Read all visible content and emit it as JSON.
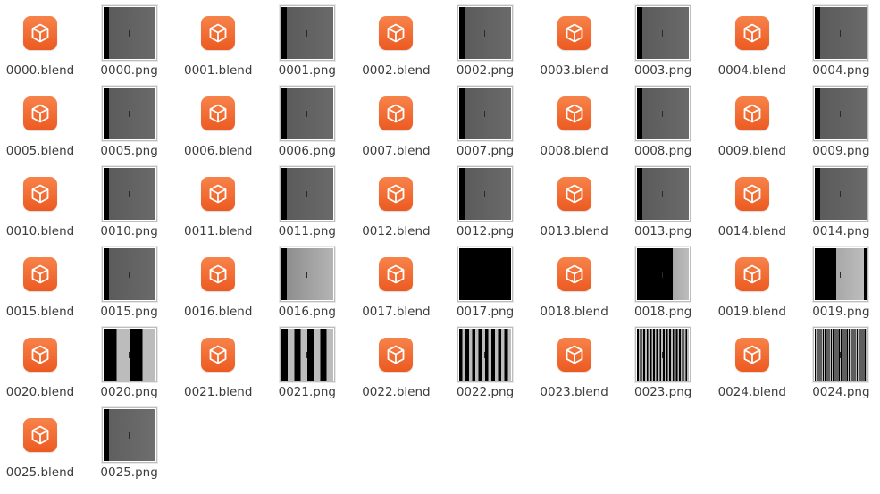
{
  "colors": {
    "blend_icon": "#ef6a2c",
    "label_text": "#3c3c3c"
  },
  "files": [
    {
      "label": "0000.blend",
      "type": "blend"
    },
    {
      "label": "0000.png",
      "type": "png",
      "style": "gray"
    },
    {
      "label": "0001.blend",
      "type": "blend"
    },
    {
      "label": "0001.png",
      "type": "png",
      "style": "gray"
    },
    {
      "label": "0002.blend",
      "type": "blend"
    },
    {
      "label": "0002.png",
      "type": "png",
      "style": "gray"
    },
    {
      "label": "0003.blend",
      "type": "blend"
    },
    {
      "label": "0003.png",
      "type": "png",
      "style": "gray"
    },
    {
      "label": "0004.blend",
      "type": "blend"
    },
    {
      "label": "0004.png",
      "type": "png",
      "style": "gray"
    },
    {
      "label": "0005.blend",
      "type": "blend"
    },
    {
      "label": "0005.png",
      "type": "png",
      "style": "gray"
    },
    {
      "label": "0006.blend",
      "type": "blend"
    },
    {
      "label": "0006.png",
      "type": "png",
      "style": "gray"
    },
    {
      "label": "0007.blend",
      "type": "blend"
    },
    {
      "label": "0007.png",
      "type": "png",
      "style": "gray"
    },
    {
      "label": "0008.blend",
      "type": "blend"
    },
    {
      "label": "0008.png",
      "type": "png",
      "style": "gray"
    },
    {
      "label": "0009.blend",
      "type": "blend"
    },
    {
      "label": "0009.png",
      "type": "png",
      "style": "gray"
    },
    {
      "label": "0010.blend",
      "type": "blend"
    },
    {
      "label": "0010.png",
      "type": "png",
      "style": "gray"
    },
    {
      "label": "0011.blend",
      "type": "blend"
    },
    {
      "label": "0011.png",
      "type": "png",
      "style": "gray"
    },
    {
      "label": "0012.blend",
      "type": "blend"
    },
    {
      "label": "0012.png",
      "type": "png",
      "style": "gray"
    },
    {
      "label": "0013.blend",
      "type": "blend"
    },
    {
      "label": "0013.png",
      "type": "png",
      "style": "gray"
    },
    {
      "label": "0014.blend",
      "type": "blend"
    },
    {
      "label": "0014.png",
      "type": "png",
      "style": "gray"
    },
    {
      "label": "0015.blend",
      "type": "blend"
    },
    {
      "label": "0015.png",
      "type": "png",
      "style": "gray"
    },
    {
      "label": "0016.blend",
      "type": "blend"
    },
    {
      "label": "0016.png",
      "type": "png",
      "style": "lightgray"
    },
    {
      "label": "0017.blend",
      "type": "blend"
    },
    {
      "label": "0017.png",
      "type": "png",
      "style": "black"
    },
    {
      "label": "0018.blend",
      "type": "blend"
    },
    {
      "label": "0018.png",
      "type": "png",
      "style": "half"
    },
    {
      "label": "0019.blend",
      "type": "blend"
    },
    {
      "label": "0019.png",
      "type": "png",
      "style": "half2"
    },
    {
      "label": "0020.blend",
      "type": "blend"
    },
    {
      "label": "0020.png",
      "type": "png",
      "style": "stripes2"
    },
    {
      "label": "0021.blend",
      "type": "blend"
    },
    {
      "label": "0021.png",
      "type": "png",
      "style": "stripes4"
    },
    {
      "label": "0022.blend",
      "type": "blend"
    },
    {
      "label": "0022.png",
      "type": "png",
      "style": "stripes8"
    },
    {
      "label": "0023.blend",
      "type": "blend"
    },
    {
      "label": "0023.png",
      "type": "png",
      "style": "stripes16"
    },
    {
      "label": "0024.blend",
      "type": "blend"
    },
    {
      "label": "0024.png",
      "type": "png",
      "style": "stripes32"
    },
    {
      "label": "0025.blend",
      "type": "blend"
    },
    {
      "label": "0025.png",
      "type": "png",
      "style": "gray2"
    }
  ]
}
